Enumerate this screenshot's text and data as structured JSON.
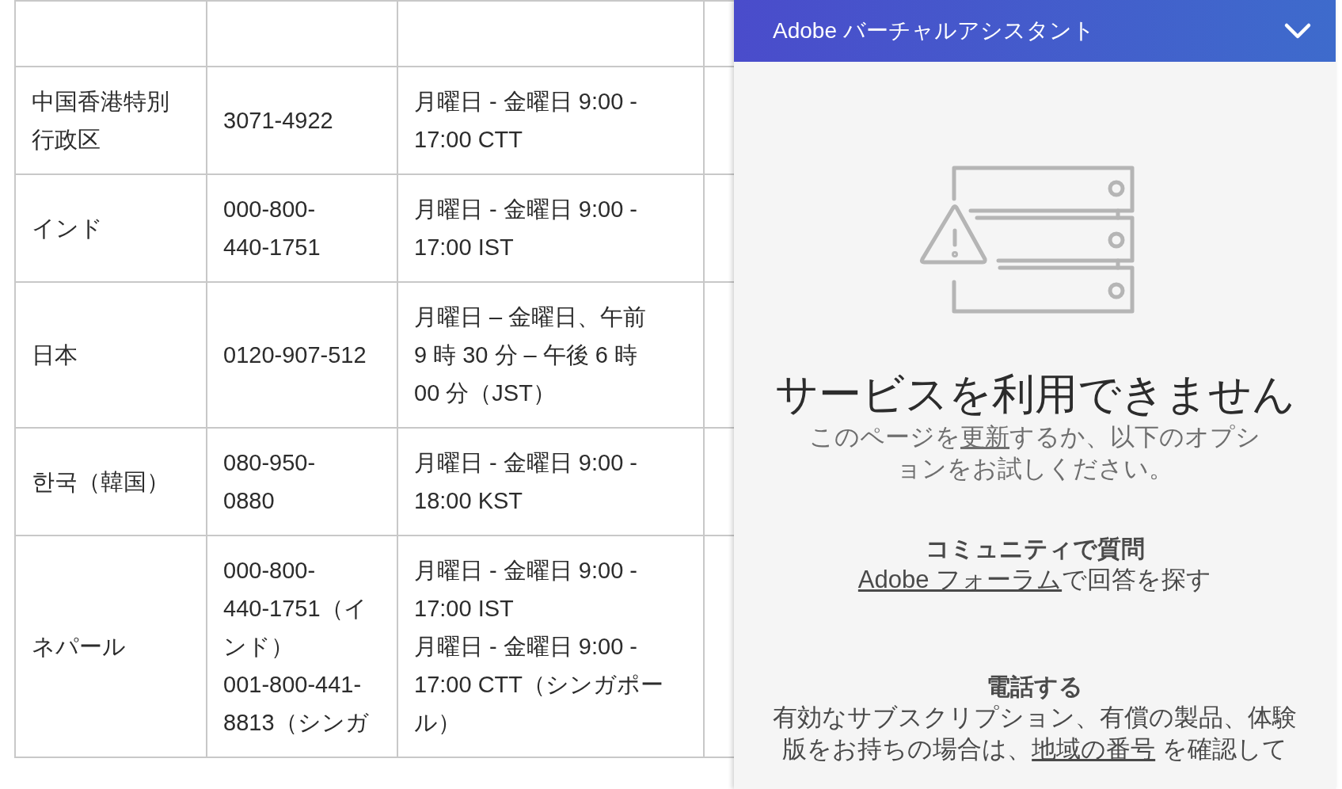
{
  "table": {
    "rows": [
      {
        "cells": [
          {
            "lines": [
              "中国香港特別",
              "行政区"
            ]
          },
          {
            "lines": [
              "3071-4922"
            ]
          },
          {
            "lines": [
              "月曜日 - 金曜日 9:00 -",
              "17:00 CTT"
            ]
          }
        ]
      },
      {
        "cells": [
          {
            "lines": [
              "インド"
            ]
          },
          {
            "lines": [
              "000-800-",
              "440-1751"
            ]
          },
          {
            "lines": [
              "月曜日 - 金曜日 9:00 -",
              "17:00 IST"
            ]
          }
        ]
      },
      {
        "cells": [
          {
            "lines": [
              "日本"
            ]
          },
          {
            "lines": [
              "0120-907-512"
            ]
          },
          {
            "lines": [
              "月曜日 – 金曜日、午前",
              "9 時 30 分 – 午後 6 時",
              "00 分（JST）"
            ]
          }
        ]
      },
      {
        "cells": [
          {
            "lines": [
              "한국（韓国）"
            ]
          },
          {
            "lines": [
              "080-950-",
              "0880"
            ]
          },
          {
            "lines": [
              "月曜日 - 金曜日 9:00 -",
              "18:00 KST"
            ]
          }
        ]
      },
      {
        "cells": [
          {
            "lines": [
              "ネパール"
            ]
          },
          {
            "lines": [
              "000-800-",
              "440-1751（イ",
              "ンド）",
              "001-800-441-",
              "8813（シンガ"
            ]
          },
          {
            "lines": [
              "月曜日 - 金曜日 9:00 -",
              "17:00 IST",
              "月曜日 - 金曜日 9:00 -",
              "17:00 CTT（シンガポー",
              "ル）"
            ]
          }
        ]
      }
    ]
  },
  "assistant": {
    "title": "Adobe バーチャルアシスタント",
    "heading": "サービスを利用できません",
    "message": {
      "before": "このページを",
      "link": "更新",
      "after": "するか、以下のオプションをお試しください。"
    },
    "sections": [
      {
        "heading": "コミュニティで質問",
        "link": "Adobe フォーラム",
        "after": "で回答を探す"
      },
      {
        "heading": "電話する",
        "before": "有効なサブスクリプション、有償の製品、体験版をお持ちの場合は、",
        "link": "地域の番号",
        "after": " を確認して"
      }
    ]
  }
}
